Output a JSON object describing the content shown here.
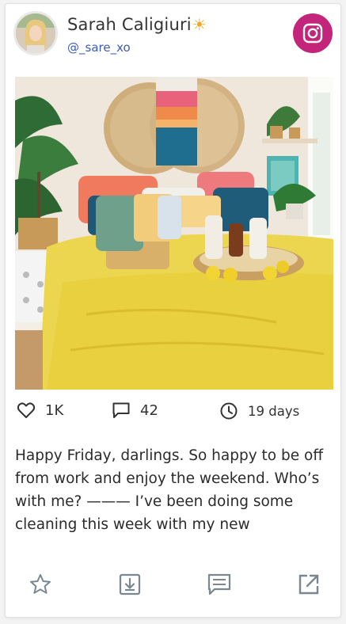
{
  "user": {
    "name": "Sarah Caligiuri",
    "emoji": "☀",
    "handle": "@_sare_xo"
  },
  "icons": {
    "instagram": "instagram-icon",
    "like": "heart-icon",
    "comments": "comment-icon",
    "time": "clock-icon",
    "favorite": "star-icon",
    "download": "download-icon",
    "reply": "message-icon",
    "open": "external-link-icon"
  },
  "stats": {
    "likes": "1K",
    "comments": "42",
    "age": "19 days"
  },
  "caption": "Happy Friday, darlings. So happy to be off from work and enjoy the weekend. Who’s with me? ——— I’ve been doing some cleaning this week with my new",
  "colors": {
    "instagram_bg": "#c2257a",
    "handle": "#3b5bb8",
    "icon_gray": "#7a8791"
  }
}
